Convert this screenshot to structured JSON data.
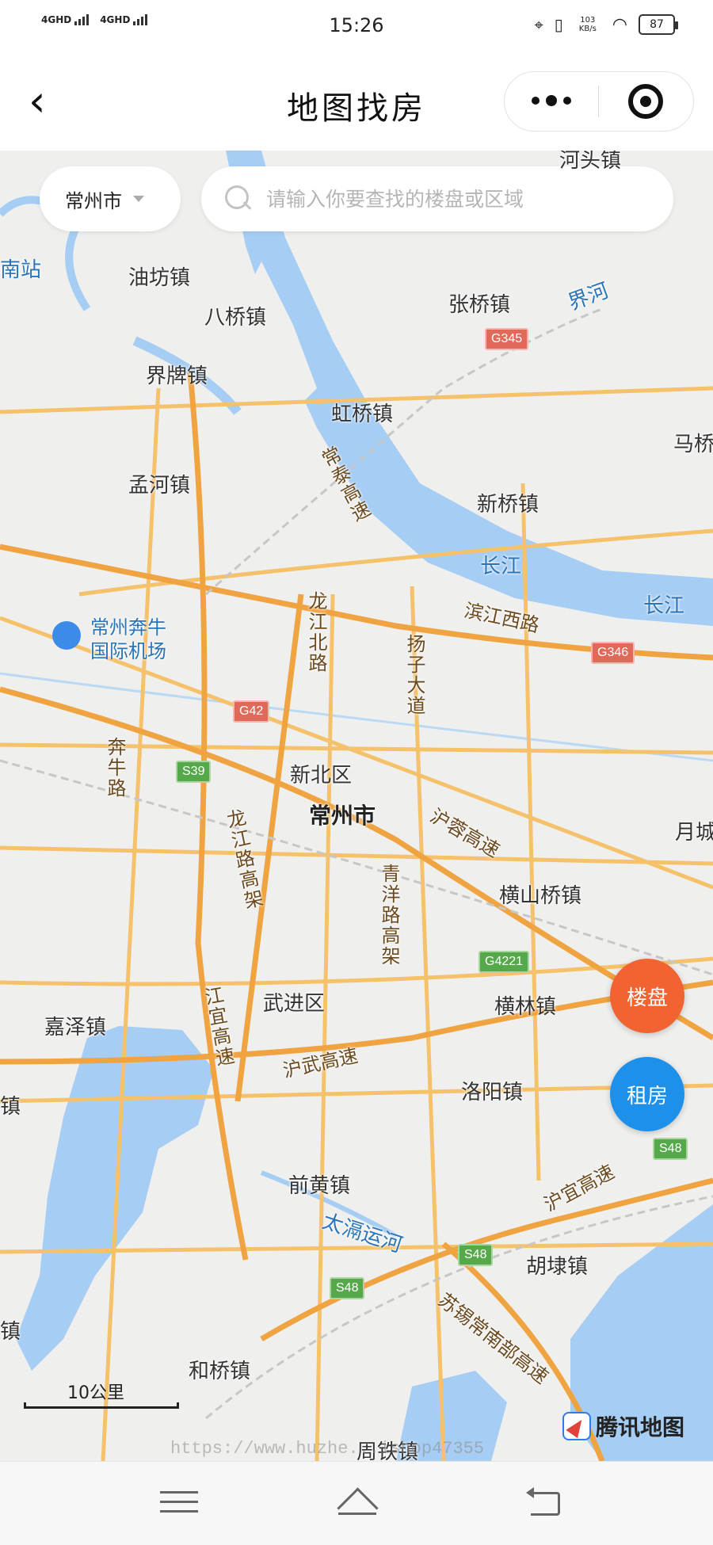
{
  "status_bar": {
    "signal_1": "4GHD",
    "signal_2": "4GHD",
    "time": "15:26",
    "net_speed": "103 KB/s",
    "battery": "87"
  },
  "nav": {
    "title": "地图找房"
  },
  "map": {
    "city_selector": "常州市",
    "search_placeholder": "请输入你要查找的楼盘或区域",
    "labels": {
      "hejia": "河头镇",
      "youfang": "油坊镇",
      "baqiao": "八桥镇",
      "jiepai": "界牌镇",
      "zhangqiao": "张桥镇",
      "jiehe": "界河",
      "hongqiao": "虹桥镇",
      "mengh": "孟河镇",
      "xinqiao": "新桥镇",
      "ma": "马桥",
      "changjiang1": "长江",
      "changjiang2": "长江",
      "changtai": "常泰高速",
      "longjiangbei": "龙江北路",
      "yangzi": "扬子大道",
      "binjiang": "滨江西路",
      "airport1": "常州奔牛",
      "airport2": "国际机场",
      "benniu": "奔牛路",
      "xinbei": "新北区",
      "changzhou": "常州市",
      "hurong": "沪蓉高速",
      "yue": "月城",
      "longjianggao": "龙江路高架",
      "qingyang": "青洋路高架",
      "hengshanqiao": "横山桥镇",
      "hengqiao": "横林镇",
      "wujin": "武进区",
      "jiaze": "嘉泽镇",
      "jiangyi": "江宜高速",
      "huwu": "沪武高速",
      "luoyang": "洛阳镇",
      "qianhuang": "前黄镇",
      "taige": "太滆运河",
      "huyi": "沪宜高速",
      "hudai": "胡埭镇",
      "suxi": "苏锡常南部高速",
      "heqiao": "和桥镇",
      "zhoutie": "周铁镇",
      "nanzhan": "南站",
      "zhen_l1": "镇",
      "zhen_l2": "镇"
    },
    "shields": {
      "g345": "G345",
      "g346": "G346",
      "g42": "G42",
      "s39": "S39",
      "g4221": "G4221",
      "s48a": "S48",
      "s48b": "S48",
      "s48c": "S48"
    },
    "scale": "10公里",
    "provider": "腾讯地图",
    "watermark": "https://www.huzhe...ishop47355"
  },
  "fab": {
    "loupan": "楼盘",
    "zufang": "租房"
  },
  "colors": {
    "water": "#a6cdf3",
    "road_main": "#f5c26b",
    "road_high": "#f0a441",
    "fab_orange": "#f26332",
    "fab_blue": "#1d90ea"
  }
}
